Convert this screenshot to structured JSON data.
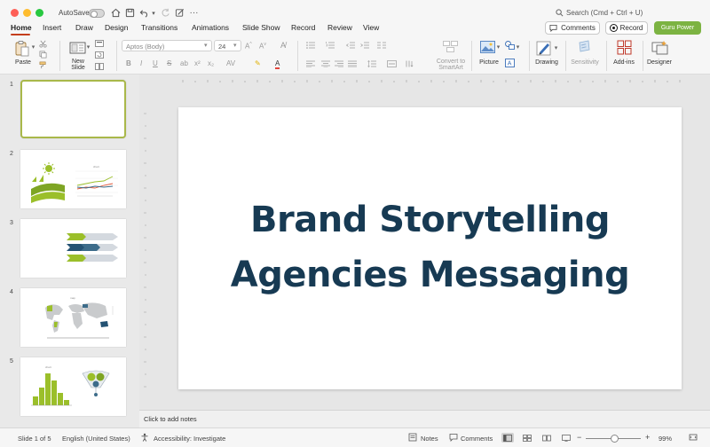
{
  "titlebar": {
    "autosave_label": "AutoSave",
    "search_text": "Search (Cmd + Ctrl + U)"
  },
  "menu": {
    "tabs": [
      "Home",
      "Insert",
      "Draw",
      "Design",
      "Transitions",
      "Animations",
      "Slide Show",
      "Record",
      "Review",
      "View"
    ],
    "active_tab": "Home",
    "comments_label": "Comments",
    "record_label": "Record",
    "guru_label": "Guru Power"
  },
  "ribbon": {
    "paste_label": "Paste",
    "new_slide_label": "New\nSlide",
    "font_name": "Aptos (Body)",
    "font_size": "24",
    "convert_label": "Convert to\nSmartArt",
    "picture_label": "Picture",
    "drawing_label": "Drawing",
    "sensitivity_label": "Sensitivity",
    "addins_label": "Add-ins",
    "designer_label": "Designer"
  },
  "thumbnails": [
    {
      "number": "1",
      "selected": true
    },
    {
      "number": "2",
      "selected": false
    },
    {
      "number": "3",
      "selected": false
    },
    {
      "number": "4",
      "selected": false
    },
    {
      "number": "5",
      "selected": false
    }
  ],
  "slide": {
    "title_line1": "Brand Storytelling",
    "title_line2": "Agencies Messaging"
  },
  "notes": {
    "placeholder": "Click to add notes"
  },
  "status": {
    "slide_position": "Slide 1 of 5",
    "language": "English (United States)",
    "accessibility": "Accessibility: Investigate",
    "notes_label": "Notes",
    "comments_label": "Comments",
    "zoom": "99%"
  },
  "colors": {
    "accent_tab": "#c43e1c",
    "guru_button": "#7cb342",
    "slide_title": "#173a53",
    "thumb_selected_border": "#a9b84a"
  }
}
